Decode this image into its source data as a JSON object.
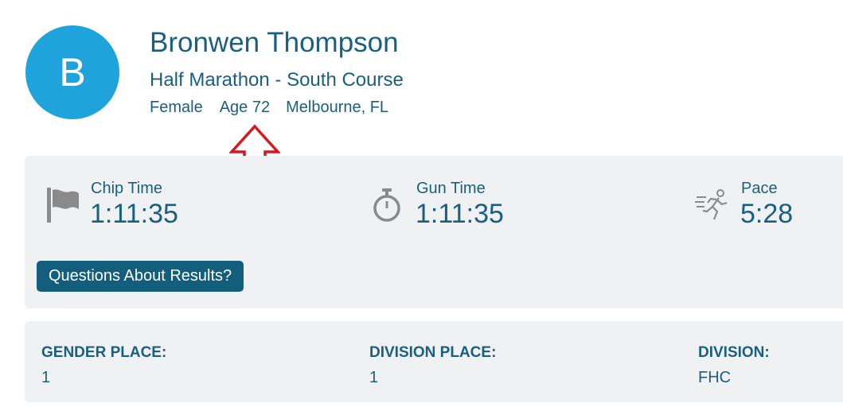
{
  "athlete": {
    "initial": "B",
    "name": "Bronwen Thompson",
    "race": "Half Marathon - South Course",
    "gender": "Female",
    "age": "Age 72",
    "location": "Melbourne, FL"
  },
  "times": {
    "chip": {
      "label": "Chip Time",
      "value": "1:11:35",
      "icon": "flag-icon"
    },
    "gun": {
      "label": "Gun Time",
      "value": "1:11:35",
      "icon": "stopwatch-icon"
    },
    "pace": {
      "label": "Pace",
      "value": "5:28",
      "icon": "runner-icon"
    }
  },
  "questions_button": {
    "label": "Questions About Results?"
  },
  "places": {
    "gender": {
      "label": "GENDER PLACE:",
      "value": "1"
    },
    "division_place": {
      "label": "DIVISION PLACE:",
      "value": "1"
    },
    "division": {
      "label": "DIVISION:",
      "value": "FHC"
    }
  },
  "colors": {
    "avatar": "#1fa3dc",
    "text": "#1b5f80",
    "button": "#135e7d",
    "card": "#f0f1f3",
    "annotation_arrow": "#d9161c"
  }
}
